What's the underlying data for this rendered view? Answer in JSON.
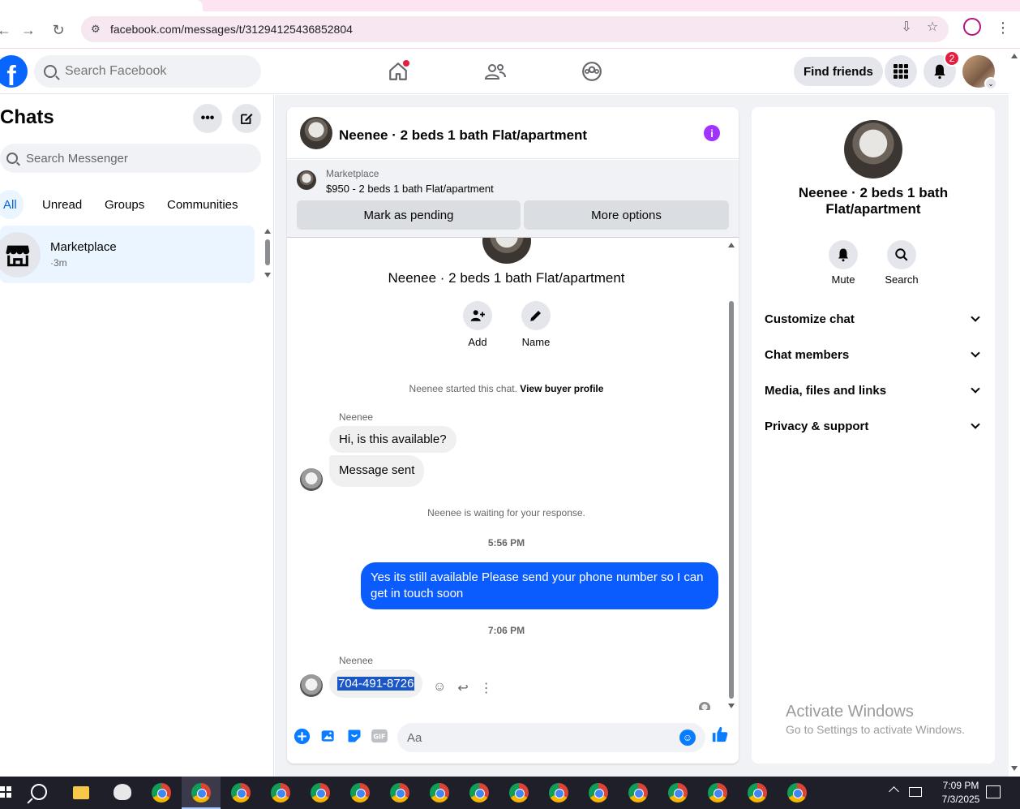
{
  "browser": {
    "url": "facebook.com/messages/t/31294125436852804"
  },
  "header": {
    "search_placeholder": "Search Facebook",
    "find_friends": "Find friends",
    "notification_count": "2"
  },
  "sidebar": {
    "title": "Chats",
    "search_placeholder": "Search Messenger",
    "filters": [
      "All",
      "Unread",
      "Groups",
      "Communities"
    ],
    "active_filter": "All",
    "chats": [
      {
        "name": "Marketplace",
        "time": "·3m"
      }
    ]
  },
  "chat": {
    "title": "Neenee · 2 beds 1 bath Flat/apartment",
    "marketplace_label": "Marketplace",
    "listing": "$950 - 2 beds 1 bath Flat/apartment",
    "mark_pending": "Mark as pending",
    "more_options": "More options",
    "actions": [
      {
        "label": "Add",
        "icon": "add-person-icon"
      },
      {
        "label": "Name",
        "icon": "pencil-icon"
      }
    ],
    "started_text": "Neenee started this chat.",
    "view_buyer_profile": "View buyer profile",
    "messages": {
      "sender_name": "Neenee",
      "msg1": "Hi, is this available?",
      "msg2": "Message sent",
      "waiting": "Neenee is waiting for your response.",
      "time1": "5:56 PM",
      "outgoing": "Yes its still available Please send your phone number so I can get in touch soon",
      "time2": "7:06 PM",
      "phone": "704-491-8726"
    },
    "composer_placeholder": "Aa"
  },
  "details": {
    "title": "Neenee · 2 beds 1 bath Flat/apartment",
    "actions": [
      {
        "label": "Mute",
        "icon": "bell-icon"
      },
      {
        "label": "Search",
        "icon": "search-icon"
      }
    ],
    "sections": [
      "Customize chat",
      "Chat members",
      "Media, files and links",
      "Privacy & support"
    ]
  },
  "watermark": {
    "line1": "Activate Windows",
    "line2": "Go to Settings to activate Windows."
  },
  "taskbar": {
    "time": "7:09 PM",
    "date": "7/3/2025"
  },
  "colors": {
    "facebook_blue": "#0866ff",
    "messenger_blue": "#0a5cff",
    "info_purple": "#a033ff"
  }
}
